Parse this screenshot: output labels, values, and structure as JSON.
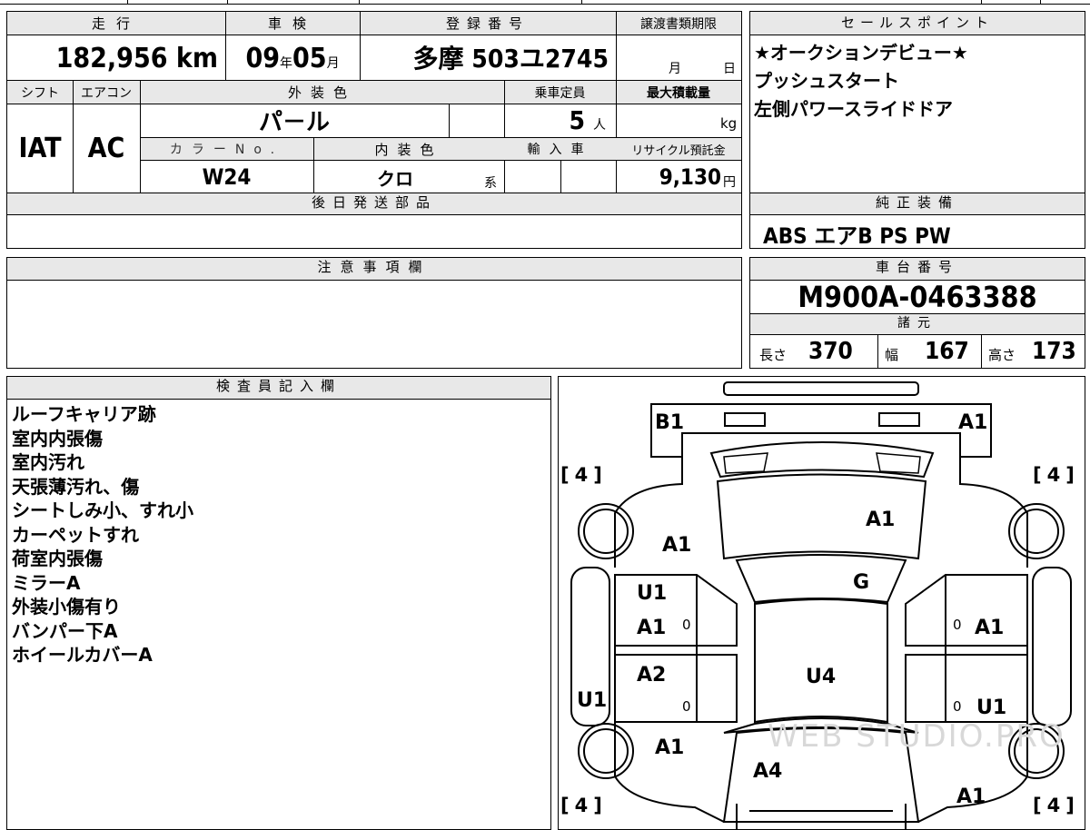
{
  "top": {
    "mileage": {
      "label": "走行",
      "value": "182,956",
      "unit": "km"
    },
    "inspection": {
      "label": "車検",
      "year": "09",
      "year_unit": "年",
      "month": "05",
      "month_unit": "月"
    },
    "registration": {
      "label": "登録番号",
      "value": "多摩 503ユ2745"
    },
    "transfer_deadline": {
      "label": "譲渡書類期限",
      "month_unit": "月",
      "day_unit": "日"
    },
    "shift": {
      "label": "シフト",
      "value": "IAT"
    },
    "aircon": {
      "label": "エアコン",
      "value": "AC"
    },
    "exterior_color": {
      "label": "外装色",
      "value": "パ－ル"
    },
    "capacity": {
      "label": "乗車定員",
      "value": "5",
      "unit": "人"
    },
    "max_load": {
      "label": "最大積載量",
      "unit": "kg"
    },
    "color_no": {
      "label": "カラーNo.",
      "value": "W24"
    },
    "interior_color": {
      "label": "内装色",
      "value": "クロ",
      "suffix": "系"
    },
    "import": {
      "label": "輸入車"
    },
    "recycle_fee": {
      "label": "リサイクル預託金",
      "value": "9,130",
      "unit": "円"
    }
  },
  "sales_points": {
    "label": "セールスポイント",
    "lines": [
      "★オークションデビュー★",
      "プッシュスタート",
      "左側パワースライドドア"
    ]
  },
  "later_parts": {
    "label": "後日発送部品"
  },
  "genuine_equipment": {
    "label": "純正装備",
    "value": "ABS エアB PS PW"
  },
  "caution": {
    "label": "注意事項欄"
  },
  "chassis_number": {
    "label": "車台番号",
    "value": "M900A-0463388"
  },
  "specs": {
    "label": "諸元",
    "length_label": "長さ",
    "length": "370",
    "width_label": "幅",
    "width": "167",
    "height_label": "高さ",
    "height": "173"
  },
  "inspector_notes": {
    "label": "検査員記入欄",
    "lines": [
      "ルーフキャリア跡",
      "室内内張傷",
      "室内汚れ",
      "天張薄汚れ、傷",
      "シートしみ小、すれ小",
      "カーペットすれ",
      "荷室内張傷",
      "ミラーA",
      "外装小傷有り",
      "バンパー下A",
      "ホイールカバーA"
    ]
  },
  "diagram": {
    "tire_depths": [
      "4",
      "4",
      "4",
      "4"
    ],
    "marks": {
      "rear_left": "B1",
      "rear_right": "A1",
      "roof": "A1",
      "left_rear_quarter": "A1",
      "rear_glass": "G",
      "left_rear_door_1": "U1",
      "left_rear_door_2": "A1",
      "left_front_door": "A2",
      "right_rear_door": "A1",
      "right_front_door": "U1",
      "left_side_u": "U1",
      "floor": "U4",
      "left_front_fender": "A1",
      "hood": "A4",
      "right_front": "A1",
      "zero": "0"
    },
    "watermark": "WEB STUDIO.PRO"
  }
}
